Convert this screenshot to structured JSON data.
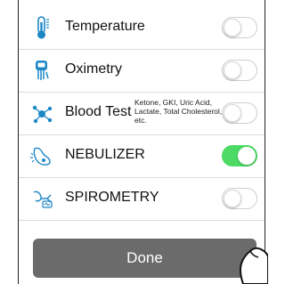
{
  "rows": [
    {
      "label": "Temperature",
      "icon": "thermometer-icon",
      "on": false
    },
    {
      "label": "Oximetry",
      "icon": "oximeter-icon",
      "on": false
    },
    {
      "label": "Blood Test",
      "icon": "blood-test-icon",
      "on": false,
      "note": "Ketone, GKI, Uric Acid, Lactate, Total Cholesterol, etc."
    },
    {
      "label": "NEBULIZER",
      "icon": "nebulizer-icon",
      "on": true
    },
    {
      "label": "SPIROMETRY",
      "icon": "spirometry-icon",
      "on": false
    }
  ],
  "done_label": "Done",
  "colors": {
    "toggle_on": "#4cd964",
    "icon_blue": "#1e88c7",
    "button": "#6b6b6b"
  }
}
